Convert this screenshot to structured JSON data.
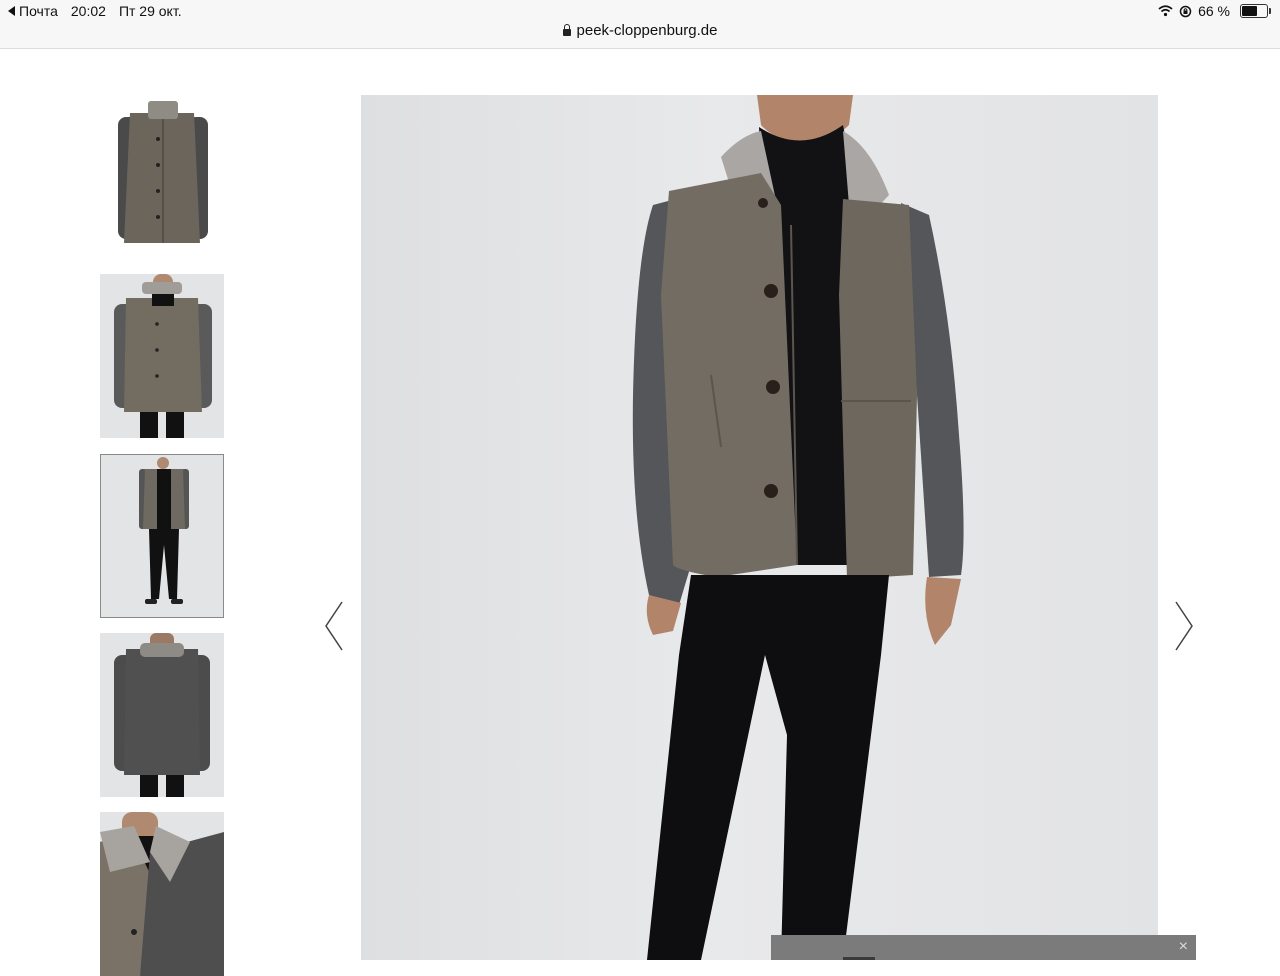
{
  "status_bar": {
    "back_app": "Почта",
    "time": "20:02",
    "date": "Пт 29 окт.",
    "battery_text": "66 %",
    "battery_level": 0.66,
    "url": "peek-cloppenburg.de"
  },
  "gallery": {
    "thumbnails": [
      {
        "view": "jacket-flat",
        "selected": false
      },
      {
        "view": "front-waist-up",
        "selected": false
      },
      {
        "view": "full-body",
        "selected": true
      },
      {
        "view": "back",
        "selected": false
      },
      {
        "view": "collar-detail",
        "selected": false
      }
    ],
    "main_image": "model-wearing-suede-jacket-front"
  },
  "icons": {
    "prev": "chevron-left-icon",
    "next": "chevron-right-icon",
    "close": "close-icon"
  },
  "toast": {
    "close_label": "×"
  }
}
